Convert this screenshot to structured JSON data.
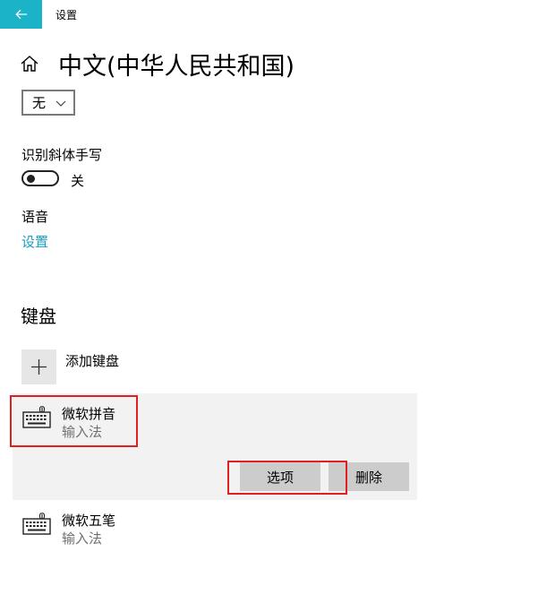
{
  "titlebar": {
    "back_icon": "arrow-left-icon",
    "title": "设置",
    "accent_color": "#1ab3c8"
  },
  "header": {
    "home_icon": "home-icon",
    "title": "中文(中华人民共和国)"
  },
  "dropdown": {
    "selected": "无",
    "icon": "chevron-down-icon"
  },
  "handwriting": {
    "label": "识别斜体手写",
    "toggle_state": "关",
    "toggle_on": false
  },
  "speech": {
    "label": "语音",
    "link": "设置",
    "link_color": "#1a9fbe"
  },
  "keyboards": {
    "heading": "键盘",
    "add": {
      "icon": "plus-icon",
      "label": "添加键盘"
    },
    "items": [
      {
        "icon": "keyboard-icon",
        "name": "微软拼音",
        "type": "输入法",
        "selected": true
      },
      {
        "icon": "keyboard-icon",
        "name": "微软五笔",
        "type": "输入法",
        "selected": false
      }
    ],
    "options_label": "选项",
    "remove_label": "删除"
  },
  "highlight_color": "#e02020"
}
